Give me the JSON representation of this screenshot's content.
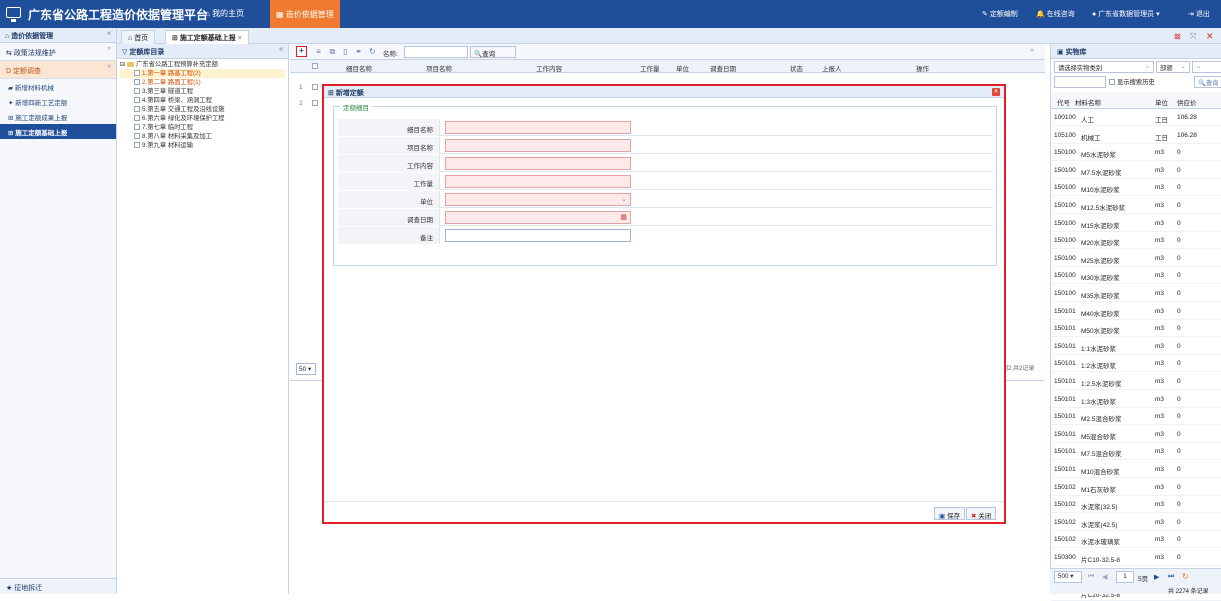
{
  "header": {
    "app_title": "广东省公路工程造价依据管理平台",
    "home_label": "我的主页",
    "module_tab": "造价依据管理",
    "right_items": [
      "定额编制",
      "在线咨询",
      "广东省数据管理员",
      "退出"
    ]
  },
  "sidebar": {
    "title": "造价依据管理",
    "sections": [
      "政策法规维护",
      "定额调查"
    ],
    "items": [
      "新增材料机械",
      "新增四新工艺定额",
      "施工定额成果上报",
      "施工定额基础上报"
    ],
    "bottom": "征地拆迁"
  },
  "tabs": [
    "首页",
    "施工定额基础上报"
  ],
  "tree": {
    "title": "定额库目录",
    "root": "广东省公路工程预算补充定额",
    "nodes": [
      "1.第一章 路基工程(2)",
      "2.第二章 路面工程(1)",
      "3.第三章 隧道工程",
      "4.第四章 桥梁、涵洞工程",
      "5.第五章 交通工程及沿线设施",
      "6.第六章 绿化及环境保护工程",
      "7.第七章 临时工程",
      "8.第八章 材料采集及加工",
      "9.第九章 材料运输"
    ]
  },
  "grid": {
    "search_label": "名称:",
    "search_button": "查询",
    "columns": [
      "细目名称",
      "项目名称",
      "工作内容",
      "工作量",
      "单位",
      "调查日期",
      "状态",
      "上报人",
      "操作"
    ],
    "row_numbers": [
      "1",
      "2"
    ],
    "page_size": "50",
    "pager_text": "到2,共2记录"
  },
  "dialog": {
    "title": "新增定额",
    "section": "定额细目",
    "fields": [
      {
        "label": "细目名称",
        "value": ""
      },
      {
        "label": "项目名称",
        "value": ""
      },
      {
        "label": "工作内容",
        "value": ""
      },
      {
        "label": "工作量",
        "value": ""
      },
      {
        "label": "单位",
        "value": ""
      },
      {
        "label": "调查日期",
        "value": ""
      },
      {
        "label": "备注",
        "value": ""
      }
    ],
    "save_label": "保存",
    "close_label": "关闭"
  },
  "material_panel": {
    "title": "实物库",
    "category_placeholder": "请选择实物类别",
    "scope": "部颁",
    "show_history": "显示搜索历史",
    "query": "查询",
    "columns": [
      "代号",
      "材料名称",
      "单位",
      "供应价"
    ],
    "rows": [
      [
        "100100",
        "人工",
        "工日",
        "106.28"
      ],
      [
        "105100",
        "机械工",
        "工日",
        "106.28"
      ],
      [
        "150100",
        "M5水泥砂浆",
        "m3",
        "0"
      ],
      [
        "150100",
        "M7.5水泥砂浆",
        "m3",
        "0"
      ],
      [
        "150100",
        "M10水泥砂浆",
        "m3",
        "0"
      ],
      [
        "150100",
        "M12.5水泥砂浆",
        "m3",
        "0"
      ],
      [
        "150100",
        "M15水泥砂浆",
        "m3",
        "0"
      ],
      [
        "150100",
        "M20水泥砂浆",
        "m3",
        "0"
      ],
      [
        "150100",
        "M25水泥砂浆",
        "m3",
        "0"
      ],
      [
        "150100",
        "M30水泥砂浆",
        "m3",
        "0"
      ],
      [
        "150100",
        "M35水泥砂浆",
        "m3",
        "0"
      ],
      [
        "150101",
        "M40水泥砂浆",
        "m3",
        "0"
      ],
      [
        "150101",
        "M50水泥砂浆",
        "m3",
        "0"
      ],
      [
        "150101",
        "1:1水泥砂浆",
        "m3",
        "0"
      ],
      [
        "150101",
        "1:2水泥砂浆",
        "m3",
        "0"
      ],
      [
        "150101",
        "1:2.5水泥砂浆",
        "m3",
        "0"
      ],
      [
        "150101",
        "1:3水泥砂浆",
        "m3",
        "0"
      ],
      [
        "150101",
        "M2.5混合砂浆",
        "m3",
        "0"
      ],
      [
        "150101",
        "M5混合砂浆",
        "m3",
        "0"
      ],
      [
        "150101",
        "M7.5混合砂浆",
        "m3",
        "0"
      ],
      [
        "150101",
        "M10混合砂浆",
        "m3",
        "0"
      ],
      [
        "150102",
        "M1石灰砂浆",
        "m3",
        "0"
      ],
      [
        "150102",
        "水泥浆(32.5)",
        "m3",
        "0"
      ],
      [
        "150102",
        "水泥浆(42.5)",
        "m3",
        "0"
      ],
      [
        "150102",
        "水泥水玻璃浆",
        "m3",
        "0"
      ],
      [
        "150300",
        "片C10-32.5-8",
        "m3",
        "0"
      ],
      [
        "150300",
        "片C15-32.5-8",
        "m3",
        "0"
      ],
      [
        "150300",
        "片C20-32.5-8",
        "m3",
        "0"
      ]
    ],
    "page_size": "500",
    "page": "1",
    "pages": "5页",
    "total": "共 2274 条记录"
  }
}
